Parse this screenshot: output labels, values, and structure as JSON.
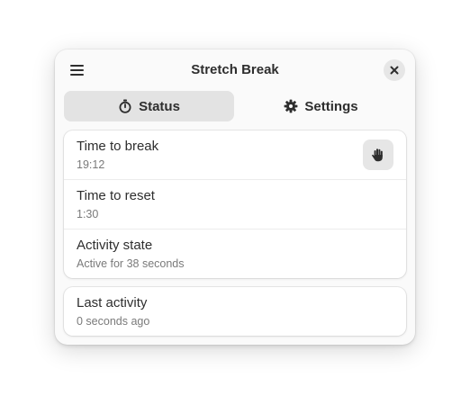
{
  "window": {
    "title": "Stretch Break",
    "menu_icon": "hamburger-menu-icon",
    "close_icon": "close-icon"
  },
  "tabs": [
    {
      "label": "Status",
      "icon": "stopwatch-icon",
      "active": true
    },
    {
      "label": "Settings",
      "icon": "gear-icon",
      "active": false
    }
  ],
  "status": {
    "rows": [
      {
        "label": "Time to break",
        "value": "19:12",
        "action_icon": "raised-hand-icon"
      },
      {
        "label": "Time to reset",
        "value": "1:30"
      },
      {
        "label": "Activity state",
        "value": "Active for 38 seconds"
      }
    ],
    "last_activity": {
      "label": "Last activity",
      "value": "0 seconds ago"
    }
  },
  "colors": {
    "window_bg": "#fafafa",
    "card_bg": "#ffffff",
    "active_tab_bg": "#e3e3e3",
    "button_bg": "#e6e6e6",
    "text_primary": "#2e2e2e",
    "text_secondary": "#7a7a7a"
  }
}
